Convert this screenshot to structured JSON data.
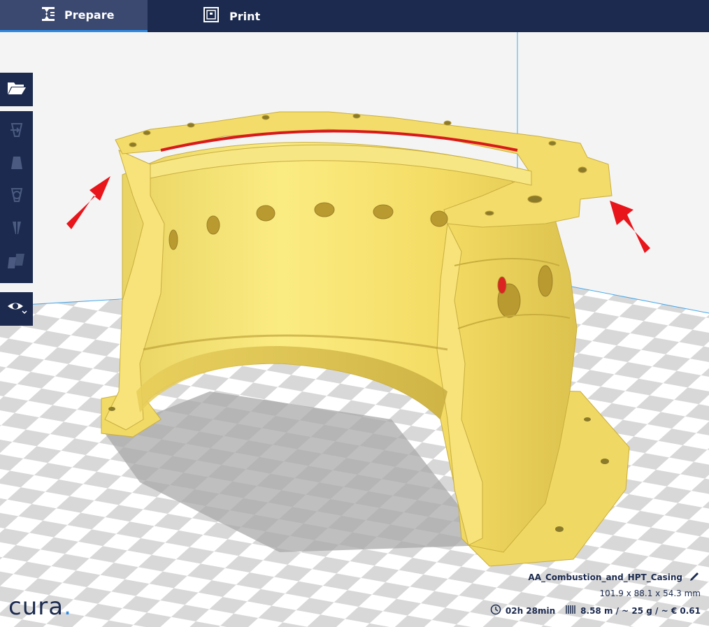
{
  "tabs": {
    "prepare": "Prepare",
    "print": "Print"
  },
  "toolbar": {
    "open_icon": "folder-open-icon",
    "tools": [
      "move-icon",
      "scale-icon",
      "rotate-icon",
      "mirror-icon",
      "per-model-settings-icon"
    ],
    "view_icon": "eye-icon"
  },
  "model": {
    "name": "AA_Combustion_and_HPT_Casing",
    "dimensions": "101.9 x 88.1 x 54.3 mm",
    "print_time": "02h 28min",
    "material": "8.58 m / ~ 25 g / ~ € 0.61"
  },
  "brand": {
    "logo_text": "cura",
    "logo_dot": "."
  },
  "colors": {
    "header": "#1b2a4e",
    "header_active": "#3b4870",
    "accent": "#2d8ee8",
    "model": "#f5e06a",
    "arrow": "#e8151b"
  }
}
